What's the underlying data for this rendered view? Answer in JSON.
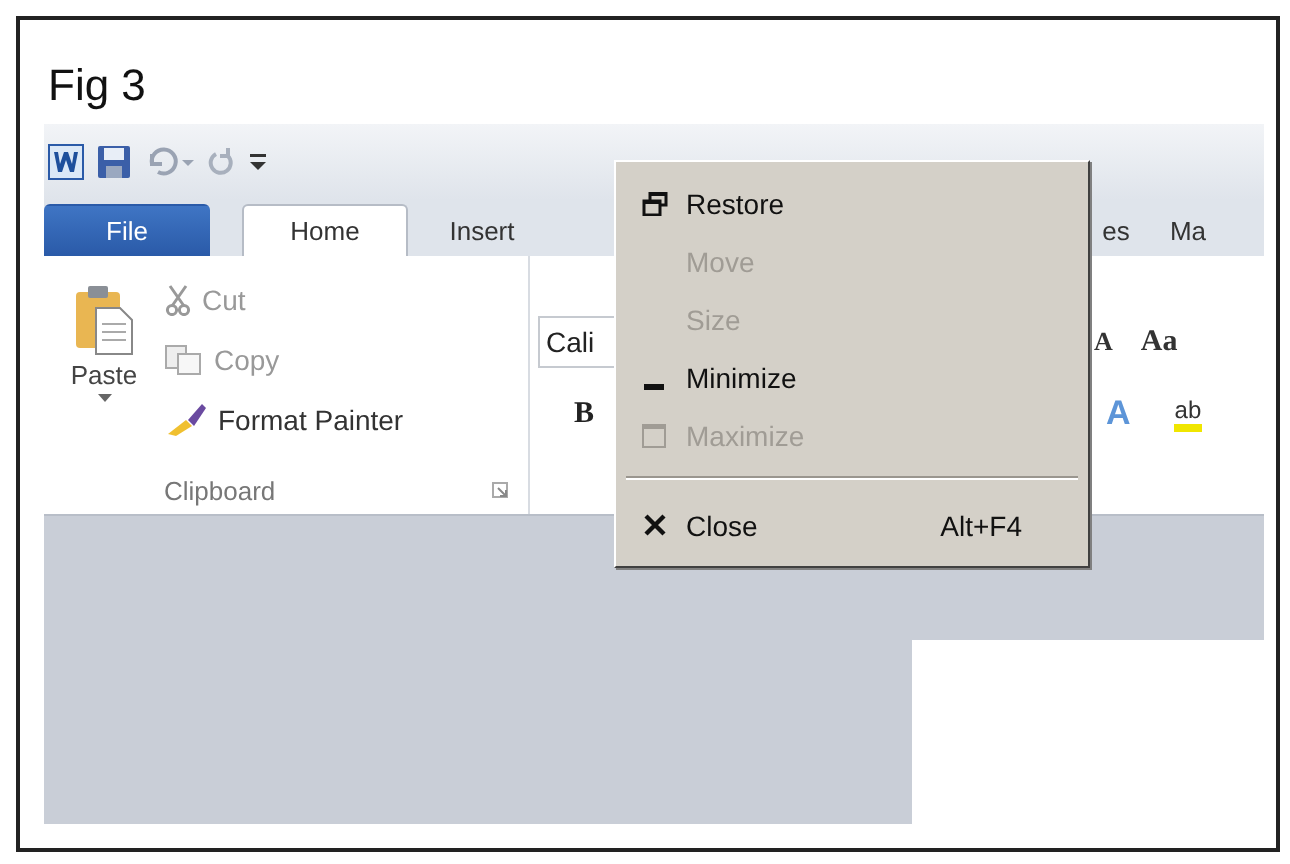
{
  "figure": {
    "label": "Fig 3"
  },
  "tabs": [
    {
      "label": "File",
      "kind": "file",
      "selected": false
    },
    {
      "label": "Home",
      "kind": "tab",
      "selected": true
    },
    {
      "label": "Insert",
      "kind": "tab",
      "selected": false
    },
    {
      "label": "es",
      "kind": "tab",
      "selected": false
    },
    {
      "label": "Ma",
      "kind": "tab",
      "selected": false
    }
  ],
  "clipboard": {
    "paste": "Paste",
    "cut": "Cut",
    "copy": "Copy",
    "format_painter": "Format Painter",
    "group_label": "Clipboard"
  },
  "font": {
    "font_name": "Cali",
    "bold": "B",
    "grow_font": "A",
    "change_case": "Aa",
    "text_effects": "A",
    "highlight": "ab"
  },
  "system_menu": [
    {
      "kind": "restore",
      "label": "Restore",
      "disabled": false
    },
    {
      "kind": "plain",
      "label": "Move",
      "disabled": true
    },
    {
      "kind": "plain",
      "label": "Size",
      "disabled": true
    },
    {
      "kind": "minimize",
      "label": "Minimize",
      "disabled": false
    },
    {
      "kind": "maximize",
      "label": "Maximize",
      "disabled": true
    },
    {
      "kind": "separator"
    },
    {
      "kind": "close",
      "label": "Close",
      "shortcut": "Alt+F4",
      "disabled": false
    }
  ]
}
